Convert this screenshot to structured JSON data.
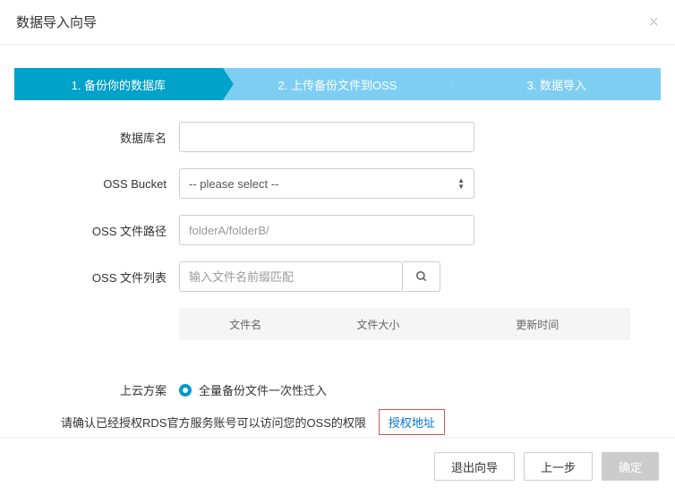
{
  "header": {
    "title": "数据导入向导"
  },
  "steps": {
    "current_index": 0,
    "items": [
      {
        "label": "1. 备份你的数据库"
      },
      {
        "label": "2. 上传备份文件到OSS"
      },
      {
        "label": "3. 数据导入"
      }
    ]
  },
  "form": {
    "db_name": {
      "label": "数据库名",
      "value": ""
    },
    "oss_bucket": {
      "label": "OSS Bucket",
      "selected": "-- please select --"
    },
    "oss_path": {
      "label": "OSS 文件路径",
      "placeholder": "folderA/folderB/",
      "value": ""
    },
    "oss_list": {
      "label": "OSS 文件列表",
      "placeholder": "输入文件名前缀匹配",
      "value": ""
    }
  },
  "table": {
    "columns": [
      "文件名",
      "文件大小",
      "更新时间"
    ]
  },
  "migration": {
    "label": "上云方案",
    "option": "全量备份文件一次性迁入"
  },
  "auth": {
    "text": "请确认已经授权RDS官方服务账号可以访问您的OSS的权限",
    "link_label": "授权地址"
  },
  "footer": {
    "exit": "退出向导",
    "prev": "上一步",
    "confirm": "确定"
  }
}
